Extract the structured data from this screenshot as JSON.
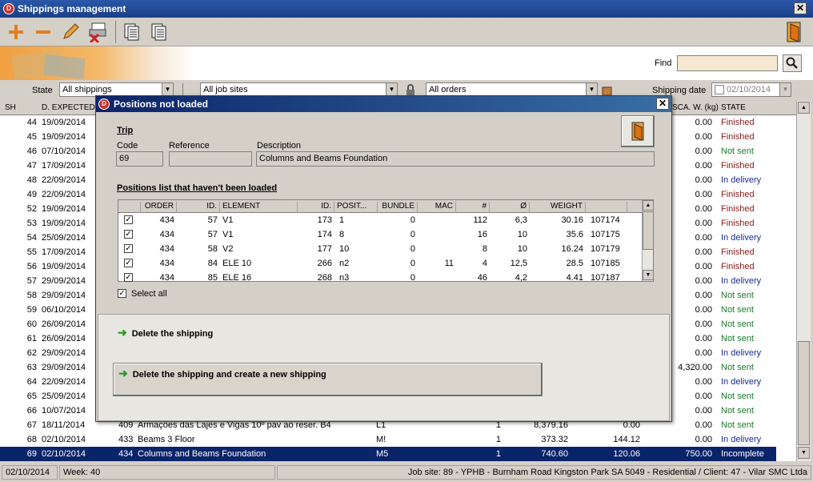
{
  "window": {
    "title": "Shippings management",
    "icon": "D"
  },
  "toolbar": {
    "icons": [
      "add-icon",
      "remove-icon",
      "edit-icon",
      "cancel-print-icon",
      "copy-doc-icon",
      "copy-doc2-icon",
      "exit-door-icon"
    ]
  },
  "find": {
    "label": "Find",
    "value": ""
  },
  "filters": {
    "state_label": "State",
    "state_value": "All shippings",
    "jobsite_value": "All job sites",
    "orders_value": "All orders",
    "date_label": "Shipping date",
    "date_value": "02/10/2014"
  },
  "grid": {
    "headers": {
      "sh": "SH",
      "dexp": "D. EXPECTED",
      "scaw": "SCA. W. (kg)",
      "state": "STATE"
    },
    "rows": [
      {
        "sh": "44",
        "date": "19/09/2014",
        "scaw": "0.00",
        "state": "Finished",
        "c": "f"
      },
      {
        "sh": "45",
        "date": "19/09/2014",
        "scaw": "0.00",
        "state": "Finished",
        "c": "f"
      },
      {
        "sh": "46",
        "date": "07/10/2014",
        "scaw": "0.00",
        "state": "Not sent",
        "c": "n"
      },
      {
        "sh": "47",
        "date": "17/09/2014",
        "scaw": "0.00",
        "state": "Finished",
        "c": "f"
      },
      {
        "sh": "48",
        "date": "22/09/2014",
        "scaw": "0.00",
        "state": "In delivery",
        "c": "d"
      },
      {
        "sh": "49",
        "date": "22/09/2014",
        "scaw": "0.00",
        "state": "Finished",
        "c": "f"
      },
      {
        "sh": "52",
        "date": "19/09/2014",
        "scaw": "0.00",
        "state": "Finished",
        "c": "f"
      },
      {
        "sh": "53",
        "date": "19/09/2014",
        "scaw": "0.00",
        "state": "Finished",
        "c": "f"
      },
      {
        "sh": "54",
        "date": "25/09/2014",
        "scaw": "0.00",
        "state": "In delivery",
        "c": "d"
      },
      {
        "sh": "55",
        "date": "17/09/2014",
        "scaw": "0.00",
        "state": "Finished",
        "c": "f"
      },
      {
        "sh": "56",
        "date": "19/09/2014",
        "scaw": "0.00",
        "state": "Finished",
        "c": "f"
      },
      {
        "sh": "57",
        "date": "29/09/2014",
        "scaw": "0.00",
        "state": "In delivery",
        "c": "d"
      },
      {
        "sh": "58",
        "date": "29/09/2014",
        "scaw": "0.00",
        "state": "Not sent",
        "c": "n"
      },
      {
        "sh": "59",
        "date": "06/10/2014",
        "scaw": "0.00",
        "state": "Not sent",
        "c": "n"
      },
      {
        "sh": "60",
        "date": "26/09/2014",
        "scaw": "0.00",
        "state": "Not sent",
        "c": "n"
      },
      {
        "sh": "61",
        "date": "26/09/2014",
        "scaw": "0.00",
        "state": "Not sent",
        "c": "n"
      },
      {
        "sh": "62",
        "date": "29/09/2014",
        "scaw": "0.00",
        "state": "In delivery",
        "c": "d"
      },
      {
        "sh": "63",
        "date": "29/09/2014",
        "scaw": "4,320.00",
        "state": "Not sent",
        "c": "n"
      },
      {
        "sh": "64",
        "date": "22/09/2014",
        "scaw": "0.00",
        "state": "In delivery",
        "c": "d"
      },
      {
        "sh": "65",
        "date": "25/09/2014",
        "scaw": "0.00",
        "state": "Not sent",
        "c": "n"
      },
      {
        "sh": "66",
        "date": "10/07/2014",
        "scaw": "0.00",
        "state": "Not sent",
        "c": "n"
      },
      {
        "sh": "67",
        "date": "18/11/2014",
        "order": "409",
        "desc": "Armações das Lajes e Vigas 10º pav ao reser. B4",
        "pos": "L1",
        "qty": "1",
        "w1": "8,379.16",
        "w2": "0.00",
        "scaw": "0.00",
        "state": "Not sent",
        "c": "n"
      },
      {
        "sh": "68",
        "date": "02/10/2014",
        "order": "433",
        "desc": "Beams 3 Floor",
        "pos": "M!",
        "qty": "1",
        "w1": "373.32",
        "w2": "144.12",
        "scaw": "0.00",
        "state": "In delivery",
        "c": "d"
      },
      {
        "sh": "69",
        "date": "02/10/2014",
        "order": "434",
        "desc": "Columns and Beams Foundation",
        "pos": "M5",
        "qty": "1",
        "w1": "740.60",
        "w2": "120.06",
        "scaw": "750.00",
        "state": "Incomplete",
        "c": "s"
      }
    ]
  },
  "status": {
    "date": "02/10/2014",
    "week": "Week: 40",
    "info": "Job site: 89 - YPHB - Burnham Road Kingston Park SA 5049 - Residential / Client: 47 - Vilar SMC Ltda"
  },
  "dialog": {
    "title": "Positions not loaded",
    "trip_label": "Trip",
    "code_label": "Code",
    "code_value": "69",
    "ref_label": "Reference",
    "ref_value": "",
    "desc_label": "Description",
    "desc_value": "Columns and Beams Foundation",
    "list_title": "Positions list that haven't been loaded",
    "list_headers": [
      "ORDER",
      "ID.",
      "ELEMENT",
      "ID.",
      "POSIT...",
      "BUNDLE",
      "MAC",
      "#",
      "Ø",
      "WEIGHT"
    ],
    "list_rows": [
      {
        "order": "434",
        "id": "57",
        "element": "V1",
        "id2": "173",
        "pos": "1",
        "bundle": "0",
        "mac": "",
        "num": "112",
        "diam": "6,3",
        "weight": "30.16",
        "code": "107174"
      },
      {
        "order": "434",
        "id": "57",
        "element": "V1",
        "id2": "174",
        "pos": "8",
        "bundle": "0",
        "mac": "",
        "num": "16",
        "diam": "10",
        "weight": "35.6",
        "code": "107175"
      },
      {
        "order": "434",
        "id": "58",
        "element": "V2",
        "id2": "177",
        "pos": "10",
        "bundle": "0",
        "mac": "",
        "num": "8",
        "diam": "10",
        "weight": "16.24",
        "code": "107179"
      },
      {
        "order": "434",
        "id": "84",
        "element": "ELE 10",
        "id2": "266",
        "pos": "n2",
        "bundle": "0",
        "mac": "11",
        "num": "4",
        "diam": "12,5",
        "weight": "28.5",
        "code": "107185"
      },
      {
        "order": "434",
        "id": "85",
        "element": "ELE 16",
        "id2": "268",
        "pos": "n3",
        "bundle": "0",
        "mac": "",
        "num": "46",
        "diam": "4,2",
        "weight": "4.41",
        "code": "107187"
      }
    ],
    "select_all": "Select all",
    "action1": "Delete the shipping",
    "action2": "Delete the shipping and create a new shipping"
  }
}
